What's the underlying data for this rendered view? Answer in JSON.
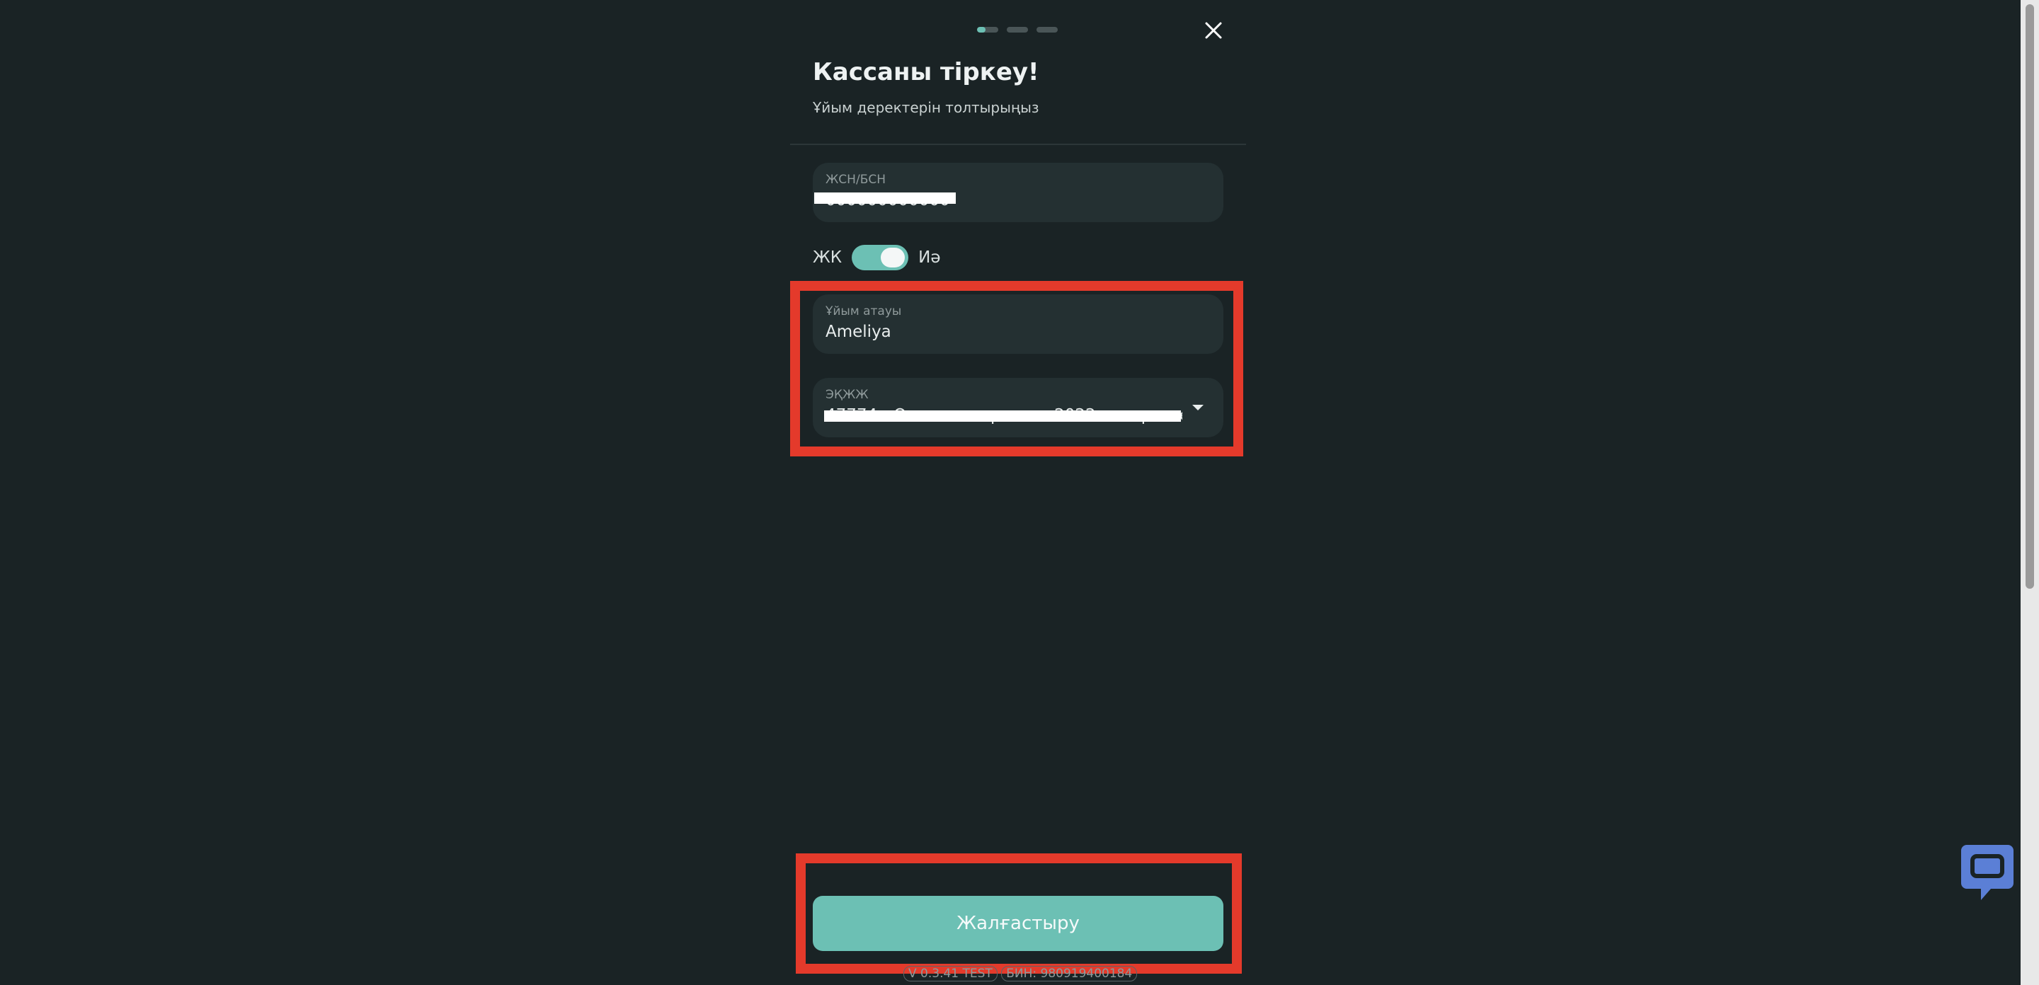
{
  "stepper": {
    "steps": 3,
    "current": 1
  },
  "header": {
    "title": "Кассаны тіркеу!",
    "subtitle": "Ұйым деректерін толтырыңыз"
  },
  "form": {
    "iin_bin": {
      "label": "ЖСН/БСН",
      "value": "000000000000"
    },
    "sole_proprietor": {
      "label_left": "ЖК",
      "label_right": "Иә",
      "checked": true
    },
    "org_name": {
      "label": "Ұйым атауы",
      "value": "Ameliya"
    },
    "okved": {
      "label": "ЭҚЖЖ",
      "value": "47774 - Оптовая торговля 2022 лекарственными средствами"
    }
  },
  "actions": {
    "continue_label": "Жалғастыру"
  },
  "footer": {
    "version": "V 0.3.41 TEST",
    "bin": "БИН: 980919400184"
  },
  "colors": {
    "background": "#1a2325",
    "field": "#243032",
    "accent": "#6cc0b4",
    "highlight": "#e43a2b",
    "chat": "#5b7fd6"
  },
  "icons": {
    "close": "close-icon",
    "dropdown": "chevron-down-icon",
    "chat": "chat-icon"
  }
}
